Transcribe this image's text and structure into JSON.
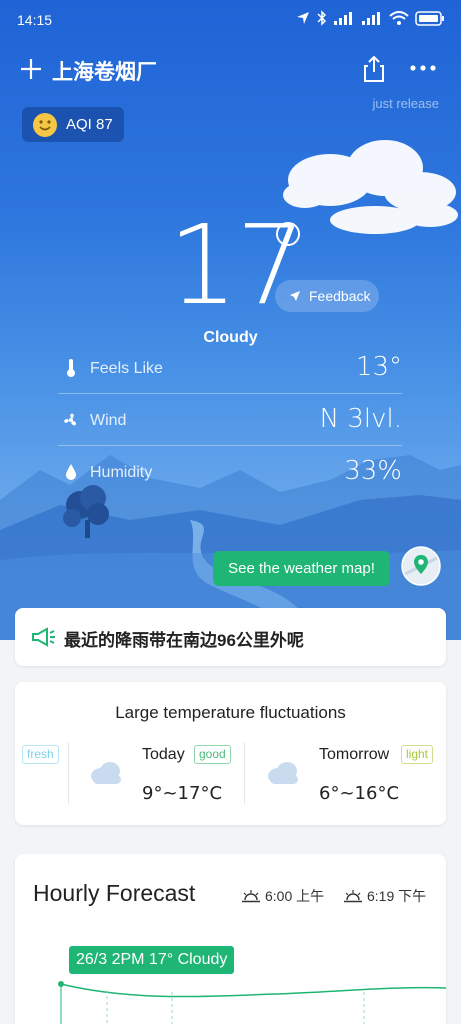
{
  "status_bar": {
    "time": "14:15"
  },
  "header": {
    "city": "上海卷烟厂",
    "release_note": "just release"
  },
  "aqi": {
    "label": "AQI 87"
  },
  "current": {
    "temperature": "17",
    "condition": "Cloudy",
    "feedback_label": "Feedback"
  },
  "details": [
    {
      "label": "Feels Like",
      "value": "13°",
      "icon": "thermometer-icon"
    },
    {
      "label": "Wind",
      "value": "N 3lvl.",
      "icon": "fan-icon"
    },
    {
      "label": "Humidity",
      "value": "33%",
      "icon": "droplet-icon"
    }
  ],
  "map_button": {
    "label": "See the weather map!"
  },
  "alert": {
    "text": "最近的降雨带在南边96公里外呢"
  },
  "fluctuation": {
    "title": "Large temperature fluctuations",
    "prev_tag": "fresh",
    "days": [
      {
        "name": "Today",
        "tag": "good",
        "range": "9°~17°C"
      },
      {
        "name": "Tomorrow",
        "tag": "light",
        "range": "6°~16°C"
      }
    ]
  },
  "hourly": {
    "title": "Hourly Forecast",
    "sunrise": "6:00 上午",
    "sunset": "6:19 下午",
    "selected": "26/3 2PM 17° Cloudy"
  },
  "colors": {
    "accent_green": "#1fb574",
    "tag_good": "#4dbb7a",
    "tag_light": "#a7c93a",
    "tag_fresh": "#7fd0e8"
  }
}
